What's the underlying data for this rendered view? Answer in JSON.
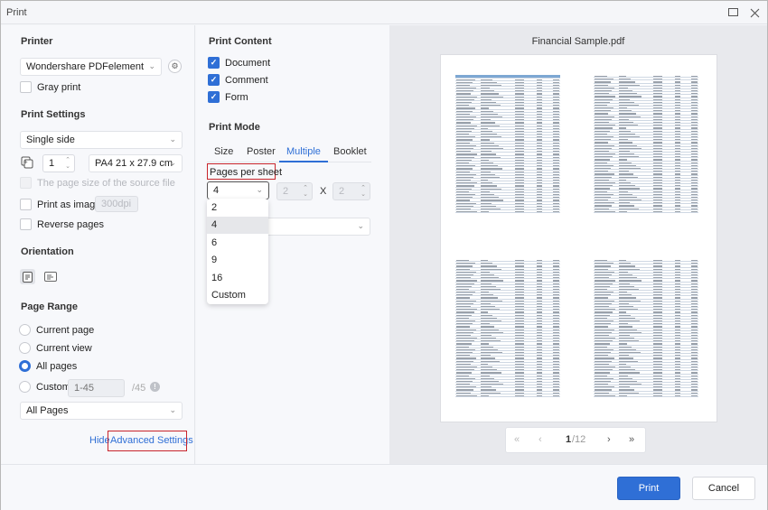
{
  "window": {
    "title": "Print",
    "maximize_icon": "maximize-icon",
    "close_icon": "close-icon"
  },
  "left": {
    "printer_heading": "Printer",
    "printer_value": "Wondershare PDFelement",
    "gray_print": {
      "label": "Gray print",
      "checked": false
    },
    "print_settings_heading": "Print Settings",
    "sides_value": "Single side",
    "copies_value": "1",
    "paper_value": "PA4 21 x 27.9 cm",
    "source_page_size": {
      "label": "The page size of the source file",
      "checked": false,
      "disabled": true
    },
    "print_as_image": {
      "label": "Print as image",
      "checked": false
    },
    "dpi_value": "300dpi",
    "reverse_pages": {
      "label": "Reverse pages",
      "checked": false
    },
    "orientation_heading": "Orientation",
    "orientation_selected": "portrait",
    "page_range_heading": "Page Range",
    "range_options": [
      {
        "label": "Current page",
        "selected": false
      },
      {
        "label": "Current view",
        "selected": false
      },
      {
        "label": "All pages",
        "selected": true
      },
      {
        "label": "Custom",
        "selected": false
      }
    ],
    "custom_range_placeholder": "1-45",
    "custom_range_total": "/45",
    "subset_value": "All Pages",
    "hide_label": "Hide",
    "advanced_label": "Advanced Settings"
  },
  "middle": {
    "print_content_heading": "Print Content",
    "content_options": [
      {
        "label": "Document",
        "checked": true
      },
      {
        "label": "Comment",
        "checked": true
      },
      {
        "label": "Form",
        "checked": true
      }
    ],
    "print_mode_heading": "Print Mode",
    "tabs": [
      {
        "label": "Size",
        "active": false
      },
      {
        "label": "Poster",
        "active": false
      },
      {
        "label": "Multiple",
        "active": true
      },
      {
        "label": "Booklet",
        "active": false
      }
    ],
    "pages_per_sheet_label": "Pages per sheet",
    "pages_per_sheet_value": "4",
    "cols_value": "2",
    "x_label": "X",
    "rows_value": "2",
    "dropdown_options": [
      "2",
      "4",
      "6",
      "9",
      "16",
      "Custom"
    ],
    "dropdown_selected": "4"
  },
  "preview": {
    "filename": "Financial Sample.pdf",
    "current_page": "1",
    "total_pages": "/12",
    "first_icon": "«",
    "prev_icon": "‹",
    "next_icon": "›",
    "last_icon": "»"
  },
  "footer": {
    "print_label": "Print",
    "cancel_label": "Cancel"
  },
  "colors": {
    "accent": "#2f6fd6",
    "highlight_border": "#c8242b",
    "table_header": "#7da7d3"
  }
}
